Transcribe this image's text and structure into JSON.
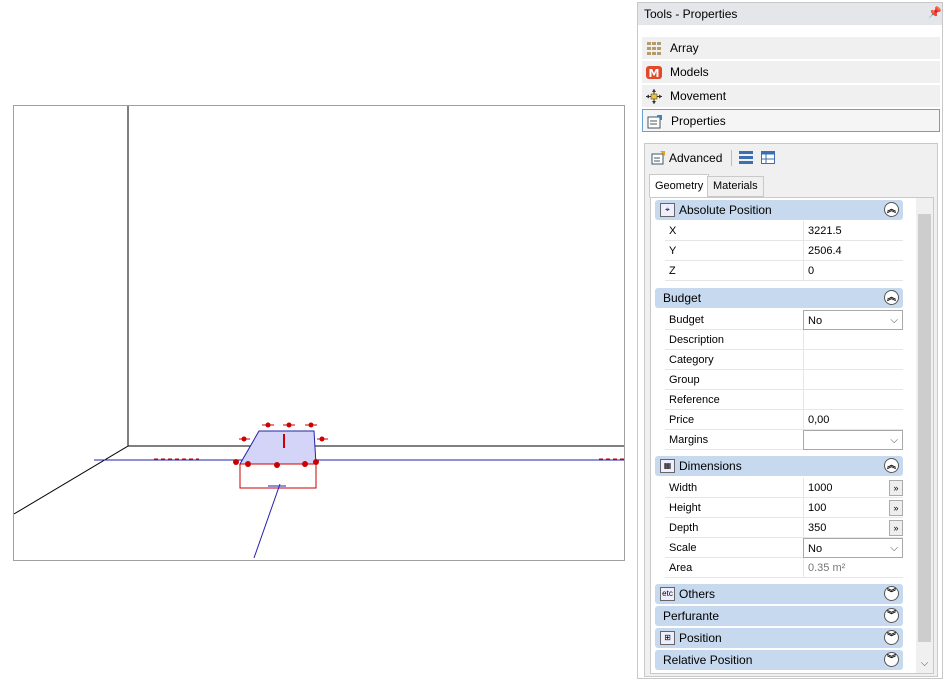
{
  "panel": {
    "title": "Tools - Properties",
    "pin_icon": "pin-icon",
    "tools": [
      {
        "label": "Array",
        "icon": "array-icon"
      },
      {
        "label": "Models",
        "icon": "models-icon"
      },
      {
        "label": "Movement",
        "icon": "movement-icon"
      },
      {
        "label": "Properties",
        "icon": "properties-icon"
      }
    ],
    "advanced_label": "Advanced",
    "tabs": [
      "Geometry",
      "Materials"
    ],
    "sections": {
      "absolute_position": {
        "title": "Absolute Position",
        "rows": [
          {
            "label": "X",
            "value": "3221.5"
          },
          {
            "label": "Y",
            "value": "2506.4"
          },
          {
            "label": "Z",
            "value": "0"
          }
        ]
      },
      "budget": {
        "title": "Budget",
        "rows": [
          {
            "label": "Budget",
            "value": "No"
          },
          {
            "label": "Description",
            "value": ""
          },
          {
            "label": "Category",
            "value": ""
          },
          {
            "label": "Group",
            "value": ""
          },
          {
            "label": "Reference",
            "value": ""
          },
          {
            "label": "Price",
            "value": "0,00"
          },
          {
            "label": "Margins",
            "value": ""
          }
        ]
      },
      "dimensions": {
        "title": "Dimensions",
        "rows": [
          {
            "label": "Width",
            "value": "1000"
          },
          {
            "label": "Height",
            "value": "100"
          },
          {
            "label": "Depth",
            "value": "350"
          },
          {
            "label": "Scale",
            "value": "No"
          },
          {
            "label": "Area",
            "value": "0.35 m²"
          }
        ]
      },
      "others": {
        "title": "Others",
        "icon_text": "etc"
      },
      "perfurante": {
        "title": "Perfurante"
      },
      "position": {
        "title": "Position"
      },
      "relative_position": {
        "title": "Relative Position"
      }
    },
    "ellipsis": "»"
  },
  "colors": {
    "accent": "#6a9fd4",
    "section_header": "#c6d9ee",
    "model_fill": "#d4d4f8",
    "model_outline": "#2222aa",
    "handles": "#cc0000"
  }
}
